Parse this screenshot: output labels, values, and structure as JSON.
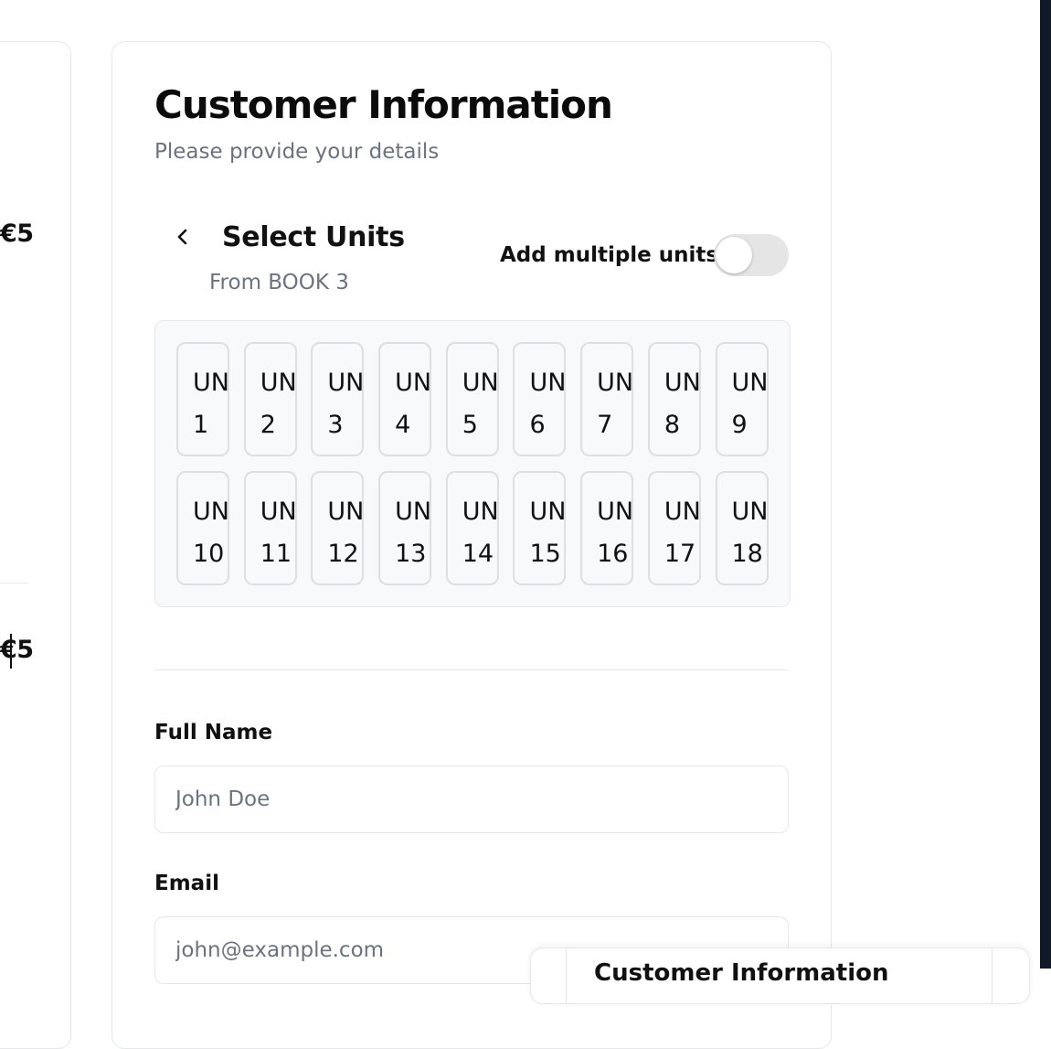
{
  "left_panel": {
    "price_1": "€5",
    "price_2": "€5"
  },
  "card": {
    "title": "Customer Information",
    "subtitle": "Please provide your details"
  },
  "unit_selector": {
    "back_icon": "chevron-left-icon",
    "title": "Select Units",
    "subtitle": "From BOOK 3",
    "toggle_label": "Add multiple units",
    "toggle_on": false,
    "units": [
      {
        "prefix": "UNIT",
        "number": "1"
      },
      {
        "prefix": "UNIT",
        "number": "2"
      },
      {
        "prefix": "UNIT",
        "number": "3"
      },
      {
        "prefix": "UNIT",
        "number": "4"
      },
      {
        "prefix": "UNIT",
        "number": "5"
      },
      {
        "prefix": "UNIT",
        "number": "6"
      },
      {
        "prefix": "UNIT",
        "number": "7"
      },
      {
        "prefix": "UNIT",
        "number": "8"
      },
      {
        "prefix": "UNIT",
        "number": "9"
      },
      {
        "prefix": "UNIT",
        "number": "10"
      },
      {
        "prefix": "UNIT",
        "number": "11"
      },
      {
        "prefix": "UNIT",
        "number": "12"
      },
      {
        "prefix": "UNIT",
        "number": "13"
      },
      {
        "prefix": "UNIT",
        "number": "14"
      },
      {
        "prefix": "UNIT",
        "number": "15"
      },
      {
        "prefix": "UNIT",
        "number": "16"
      },
      {
        "prefix": "UNIT",
        "number": "17"
      },
      {
        "prefix": "UNIT",
        "number": "18"
      }
    ]
  },
  "form": {
    "full_name_label": "Full Name",
    "full_name_placeholder": "John Doe",
    "full_name_value": "",
    "email_label": "Email",
    "email_placeholder": "john@example.com",
    "email_value": ""
  },
  "overlay_card": {
    "title": "Customer Information"
  },
  "colors": {
    "text": "#111111",
    "muted": "#6b7280",
    "border": "#e5e7eb",
    "panel_bg": "#f8f9fa",
    "toggle_off": "#e5e5e5",
    "edge_dark": "#121826"
  }
}
